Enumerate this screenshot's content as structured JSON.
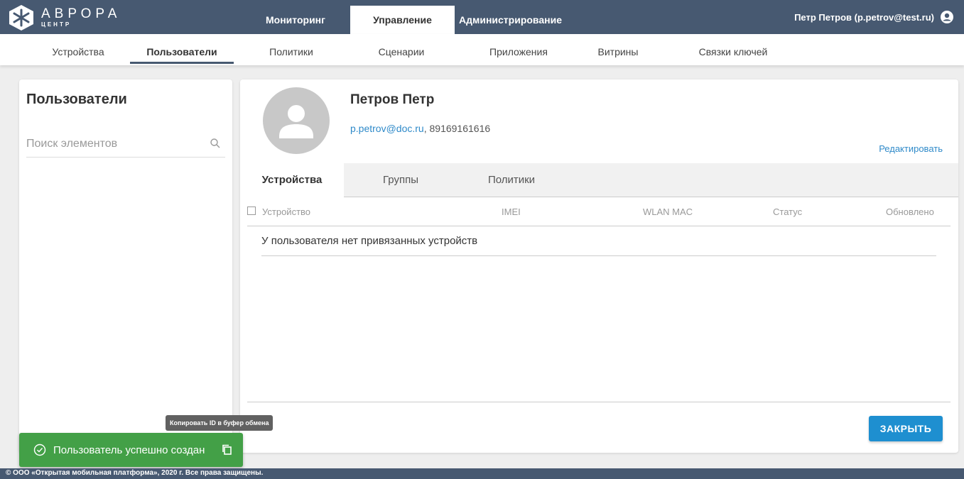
{
  "brand": {
    "title": "АВРОРА",
    "subtitle": "ЦЕНТР"
  },
  "main_nav": [
    {
      "label": "Мониторинг"
    },
    {
      "label": "Управление",
      "active": true
    },
    {
      "label": "Администрирование"
    }
  ],
  "user": {
    "label": "Петр Петров (p.petrov@test.ru)"
  },
  "sub_nav": [
    {
      "label": "Устройства"
    },
    {
      "label": "Пользователи",
      "active": true
    },
    {
      "label": "Политики"
    },
    {
      "label": "Сценарии"
    },
    {
      "label": "Приложения"
    },
    {
      "label": "Витрины"
    },
    {
      "label": "Связки ключей"
    }
  ],
  "left_panel": {
    "title": "Пользователи",
    "search_placeholder": "Поиск элементов"
  },
  "profile": {
    "name": "Петров Петр",
    "email": "p.petrov@doc.ru",
    "phone": ", 89169161616",
    "edit_label": "Редактировать"
  },
  "detail_tabs": [
    {
      "label": "Устройства",
      "active": true
    },
    {
      "label": "Группы"
    },
    {
      "label": "Политики"
    }
  ],
  "table": {
    "columns": [
      "Устройство",
      "IMEI",
      "WLAN MAC",
      "Статус",
      "Обновлено"
    ],
    "empty_message": "У пользователя нет привязанных устройств"
  },
  "close_label": "ЗАКРЫТЬ",
  "tooltip": "Копировать ID в буфер обмена",
  "toast": {
    "message": "Пользователь успешно создан"
  },
  "footer": "© ООО «Открытая мобильная платформа», 2020 г. Все права защищены.",
  "colors": {
    "header": "#475971",
    "accent": "#1e8fd0",
    "success": "#43a047",
    "link": "#2f8ac9"
  }
}
